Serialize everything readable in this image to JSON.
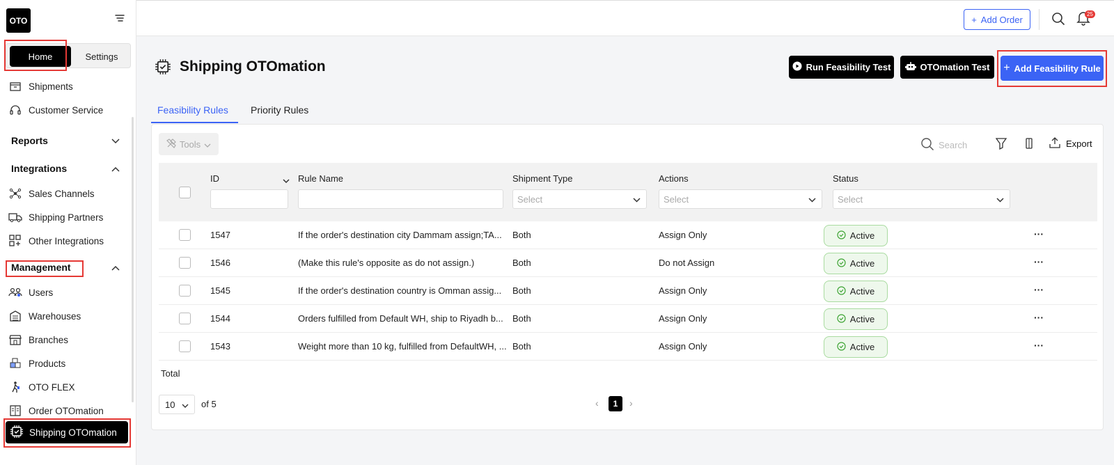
{
  "app": {
    "logo_text": "OTO"
  },
  "sidebar": {
    "home_label": "Home",
    "settings_label": "Settings",
    "items_top": [
      {
        "label": "Shipments",
        "icon": "box-icon"
      },
      {
        "label": "Customer Service",
        "icon": "headset-icon"
      }
    ],
    "reports_label": "Reports",
    "integrations_label": "Integrations",
    "integrations_items": [
      {
        "label": "Sales Channels",
        "icon": "network-icon"
      },
      {
        "label": "Shipping Partners",
        "icon": "truck-icon"
      },
      {
        "label": "Other Integrations",
        "icon": "grid-plus-icon"
      }
    ],
    "management_label": "Management",
    "management_items": [
      {
        "label": "Users",
        "icon": "users-icon"
      },
      {
        "label": "Warehouses",
        "icon": "warehouse-icon"
      },
      {
        "label": "Branches",
        "icon": "store-icon"
      },
      {
        "label": "Products",
        "icon": "products-icon"
      },
      {
        "label": "OTO FLEX",
        "icon": "walker-icon"
      },
      {
        "label": "Order OTOmation",
        "icon": "order-automation-icon"
      }
    ],
    "active_label": "Shipping OTOmation"
  },
  "topbar": {
    "add_order_label": "Add Order",
    "notification_count": "25"
  },
  "header": {
    "title": "Shipping OTOmation",
    "run_test_label": "Run Feasibility Test",
    "otomation_test_label": "OTOmation Test",
    "add_rule_label": "Add Feasibility Rule"
  },
  "tabs": [
    {
      "label": "Feasibility Rules",
      "active": true
    },
    {
      "label": "Priority Rules",
      "active": false
    }
  ],
  "toolbar": {
    "tools_label": "Tools",
    "search_placeholder": "Search",
    "export_label": "Export"
  },
  "table": {
    "columns": {
      "id": "ID",
      "rule_name": "Rule Name",
      "shipment_type": "Shipment Type",
      "actions": "Actions",
      "status": "Status"
    },
    "select_placeholder": "Select",
    "rows": [
      {
        "id": "1547",
        "rule_name": "If the order's destination city Dammam assign;TA...",
        "shipment_type": "Both",
        "action": "Assign Only",
        "status": "Active"
      },
      {
        "id": "1546",
        "rule_name": "(Make this rule's opposite as do not assign.)",
        "shipment_type": "Both",
        "action": "Do not Assign",
        "status": "Active"
      },
      {
        "id": "1545",
        "rule_name": "If the order's destination country is Omman assig...",
        "shipment_type": "Both",
        "action": "Assign Only",
        "status": "Active"
      },
      {
        "id": "1544",
        "rule_name": "Orders fulfilled from Default WH, ship to Riyadh b...",
        "shipment_type": "Both",
        "action": "Assign Only",
        "status": "Active"
      },
      {
        "id": "1543",
        "rule_name": "Weight more than 10 kg, fulfilled from DefaultWH, ...",
        "shipment_type": "Both",
        "action": "Assign Only",
        "status": "Active"
      }
    ],
    "total_label": "Total"
  },
  "pagination": {
    "page_size": "10",
    "of_label": "of 5",
    "current_page": "1"
  },
  "colors": {
    "accent": "#3b63f5",
    "highlight": "#e53935",
    "active_bg": "#eef8ec"
  }
}
